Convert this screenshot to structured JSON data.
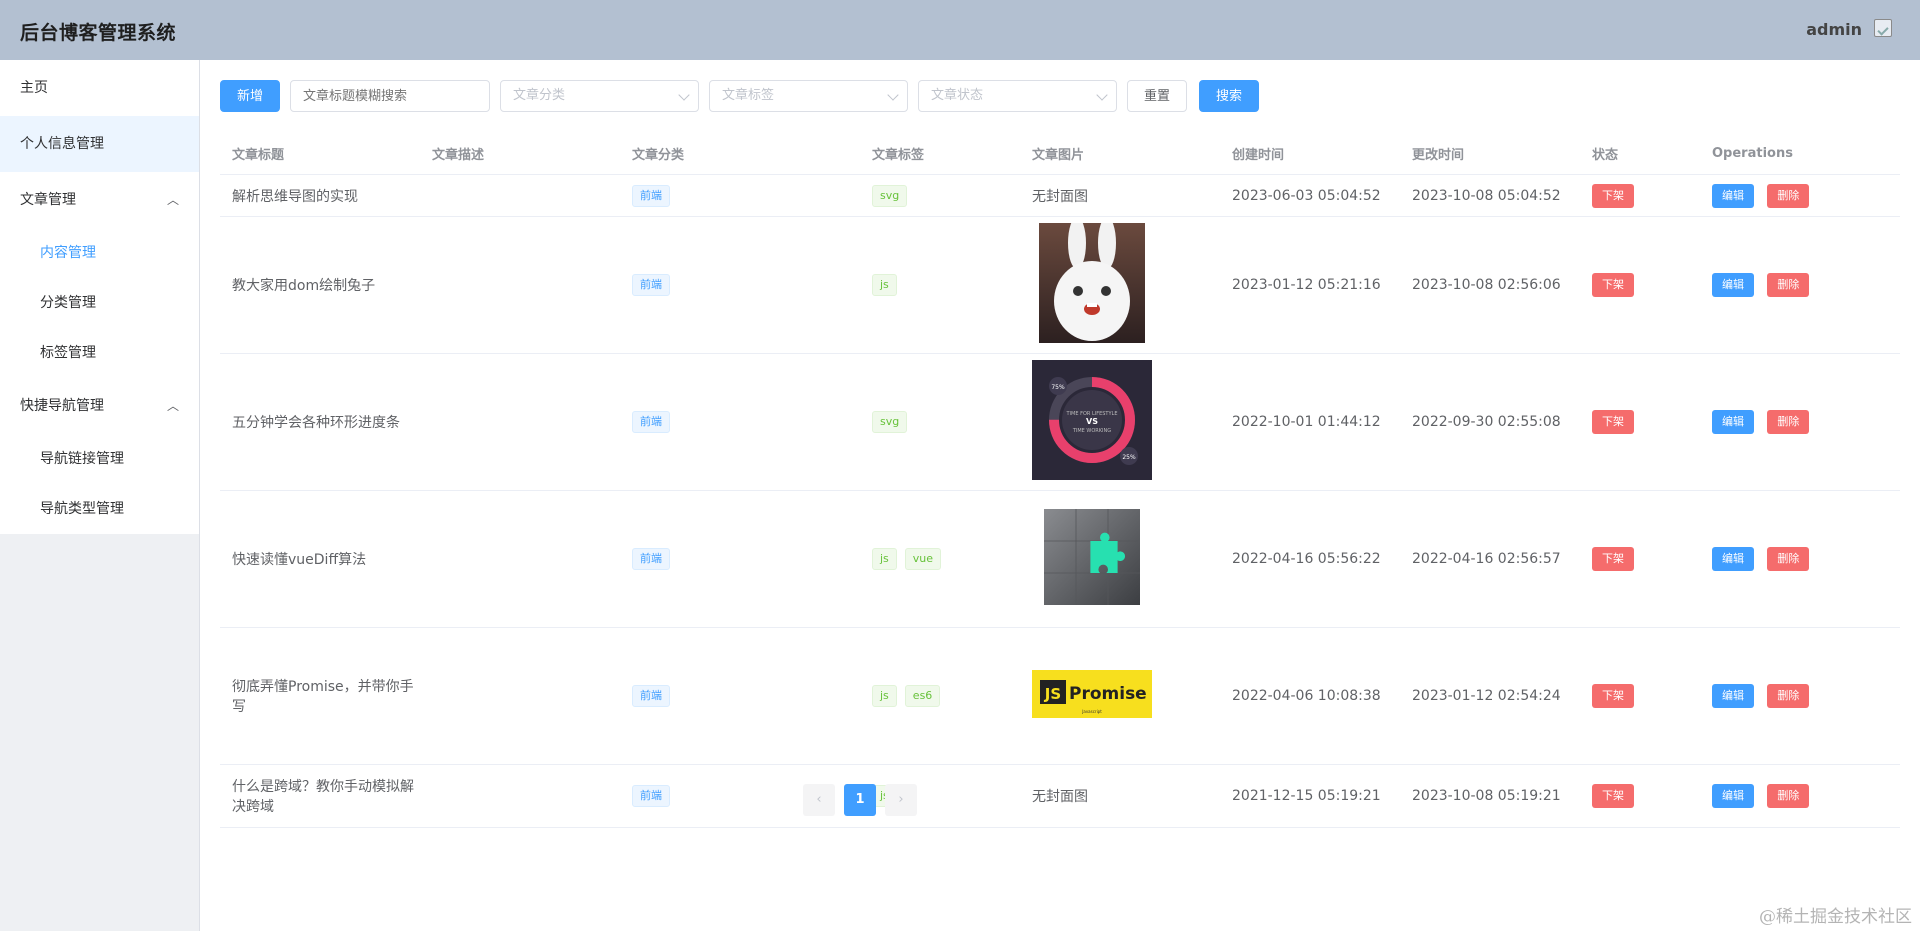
{
  "header": {
    "title": "后台博客管理系统",
    "user": "admin"
  },
  "sidebar": {
    "items": [
      {
        "label": "主页"
      },
      {
        "label": "个人信息管理"
      },
      {
        "label": "文章管理",
        "expanded": true,
        "children": [
          {
            "label": "内容管理"
          },
          {
            "label": "分类管理"
          },
          {
            "label": "标签管理"
          }
        ]
      },
      {
        "label": "快捷导航管理",
        "expanded": true,
        "children": [
          {
            "label": "导航链接管理"
          },
          {
            "label": "导航类型管理"
          }
        ]
      }
    ]
  },
  "toolbar": {
    "add_label": "新增",
    "search_placeholder": "文章标题模糊搜索",
    "category_placeholder": "文章分类",
    "tag_placeholder": "文章标签",
    "status_placeholder": "文章状态",
    "reset_label": "重置",
    "search_label": "搜索"
  },
  "table": {
    "columns": [
      "文章标题",
      "文章描述",
      "文章分类",
      "文章标签",
      "文章图片",
      "创建时间",
      "更改时间",
      "状态",
      "Operations"
    ],
    "no_cover": "无封面图",
    "offline_label": "下架",
    "edit_label": "编辑",
    "delete_label": "删除",
    "rows": [
      {
        "title": "解析思维导图的实现",
        "desc": "",
        "category": "前端",
        "tags": [
          "svg"
        ],
        "image": "",
        "created": "2023-06-03 05:04:52",
        "updated": "2023-10-08 05:04:52"
      },
      {
        "title": "教大家用dom绘制兔子",
        "desc": "",
        "category": "前端",
        "tags": [
          "js"
        ],
        "image": "bunny",
        "created": "2023-01-12 05:21:16",
        "updated": "2023-10-08 02:56:06"
      },
      {
        "title": "五分钟学会各种环形进度条",
        "desc": "",
        "category": "前端",
        "tags": [
          "svg"
        ],
        "image": "ring",
        "created": "2022-10-01 01:44:12",
        "updated": "2022-09-30 02:55:08"
      },
      {
        "title": "快速读懂vueDiff算法",
        "desc": "",
        "category": "前端",
        "tags": [
          "js",
          "vue"
        ],
        "image": "puzzle",
        "created": "2022-04-16 05:56:22",
        "updated": "2022-04-16 02:56:57"
      },
      {
        "title": "彻底弄懂Promise，并带你手写",
        "desc": "",
        "category": "前端",
        "tags": [
          "js",
          "es6"
        ],
        "image": "promise",
        "created": "2022-04-06 10:08:38",
        "updated": "2023-01-12 02:54:24"
      },
      {
        "title": "什么是跨域？教你手动模拟解决跨域",
        "desc": "",
        "category": "前端",
        "tags": [
          "js"
        ],
        "image": "",
        "created": "2021-12-15 05:19:21",
        "updated": "2023-10-08 05:19:21"
      }
    ]
  },
  "pagination": {
    "current": "1",
    "prev": "‹",
    "next": "›"
  },
  "ring_image": {
    "pct_high": "75%",
    "pct_low": "25%",
    "line1": "TIME FOR LIFESTYLE",
    "vs": "VS",
    "line2": "TIME WORKING"
  },
  "promise_image": {
    "js": "JS",
    "word": "Promise",
    "sub": "Javascript"
  },
  "watermark": "@稀土掘金技术社区"
}
